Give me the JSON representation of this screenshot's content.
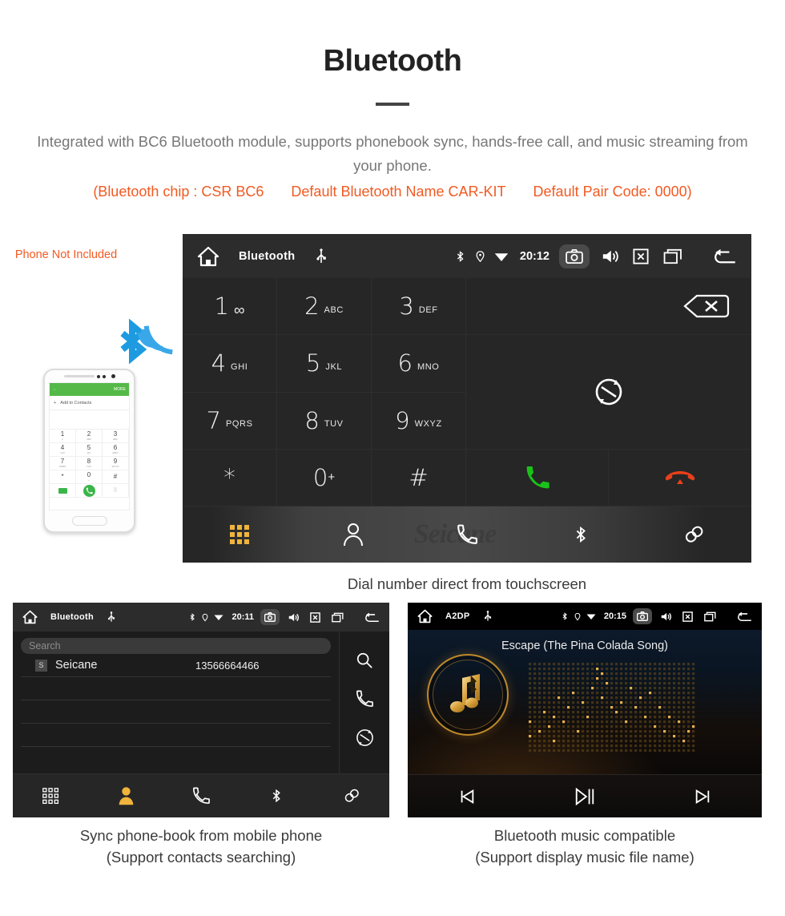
{
  "header": {
    "title": "Bluetooth",
    "subtitle": "Integrated with BC6 Bluetooth module, supports phonebook sync, hands-free call, and music streaming from your phone.",
    "specs": [
      "(Bluetooth chip : CSR BC6",
      "Default Bluetooth Name CAR-KIT",
      "Default Pair Code: 0000)"
    ],
    "accent_color": "#f15a22",
    "subtitle_color": "#777777"
  },
  "dialer": {
    "statusbar": {
      "home_icon": "home-icon",
      "title": "Bluetooth",
      "usb_icon": "usb-icon",
      "bluetooth_icon": "bluetooth-icon",
      "location_icon": "location-pin-icon",
      "wifi_icon": "wifi-icon",
      "time": "20:12",
      "camera_icon": "camera-icon",
      "volume_icon": "volume-icon",
      "close_icon": "close-box-icon",
      "recents_icon": "recent-apps-icon",
      "back_icon": "back-arrow-icon"
    },
    "keys": [
      {
        "digit": "1",
        "letters": "",
        "icon": "voicemail-icon"
      },
      {
        "digit": "2",
        "letters": "ABC",
        "icon": ""
      },
      {
        "digit": "3",
        "letters": "DEF",
        "icon": ""
      },
      {
        "digit": "4",
        "letters": "GHI",
        "icon": ""
      },
      {
        "digit": "5",
        "letters": "JKL",
        "icon": ""
      },
      {
        "digit": "6",
        "letters": "MNO",
        "icon": ""
      },
      {
        "digit": "7",
        "letters": "PQRS",
        "icon": ""
      },
      {
        "digit": "8",
        "letters": "TUV",
        "icon": ""
      },
      {
        "digit": "9",
        "letters": "WXYZ",
        "icon": ""
      },
      {
        "digit": "*",
        "letters": "",
        "icon": ""
      },
      {
        "digit": "0",
        "letters": "",
        "icon": "plus-sup"
      },
      {
        "digit": "#",
        "letters": "",
        "icon": ""
      }
    ],
    "backspace_icon": "backspace-icon",
    "transfer_icon": "audio-transfer-icon",
    "call_icon": "call-answer-icon",
    "hangup_icon": "call-end-icon",
    "call_color": "#19c219",
    "hangup_color": "#e8401a",
    "toolbar": [
      {
        "name": "keypad",
        "icon": "keypad-icon",
        "active": true
      },
      {
        "name": "contacts",
        "icon": "contact-person-icon",
        "active": false
      },
      {
        "name": "call-log",
        "icon": "phone-handset-icon",
        "active": false
      },
      {
        "name": "bluetooth",
        "icon": "bluetooth-icon",
        "active": false
      },
      {
        "name": "pair-link",
        "icon": "link-chain-icon",
        "active": false
      }
    ],
    "watermark": "Seicane",
    "active_color": "#f0b43c",
    "caption": "Dial number direct from touchscreen"
  },
  "phone_illustration": {
    "note": "Phone Not Included",
    "note_color": "#f15a22",
    "bluetooth_signal_icon": "bluetooth-wireless-icon",
    "signal_color": "#1e9be0",
    "screen": {
      "back_icon": "back-arrow-icon",
      "more_label": "MORE",
      "add_label": "Add to Contacts",
      "plus_icon": "plus-icon",
      "keys": [
        {
          "digit": "1",
          "letters": "∞"
        },
        {
          "digit": "2",
          "letters": "ABC"
        },
        {
          "digit": "3",
          "letters": "DEF"
        },
        {
          "digit": "4",
          "letters": "GHI"
        },
        {
          "digit": "5",
          "letters": "JKL"
        },
        {
          "digit": "6",
          "letters": "MNO"
        },
        {
          "digit": "7",
          "letters": "PQRS"
        },
        {
          "digit": "8",
          "letters": "TUV"
        },
        {
          "digit": "9",
          "letters": "WXYZ"
        },
        {
          "digit": "*",
          "letters": ""
        },
        {
          "digit": "0",
          "letters": "+"
        },
        {
          "digit": "#",
          "letters": ""
        }
      ],
      "video_icon": "video-call-icon",
      "call_icon": "call-answer-icon",
      "more_keys_icon": "keypad-icon",
      "green": "#54b948"
    }
  },
  "phonebook": {
    "statusbar": {
      "title": "Bluetooth",
      "time": "20:11"
    },
    "search_placeholder": "Search",
    "contacts": [
      {
        "badge": "S",
        "name": "Seicane",
        "number": "13566664466"
      }
    ],
    "rail": [
      {
        "name": "search",
        "icon": "search-icon"
      },
      {
        "name": "call",
        "icon": "phone-handset-icon"
      },
      {
        "name": "sync",
        "icon": "sync-icon"
      }
    ],
    "toolbar": [
      {
        "name": "keypad",
        "icon": "keypad-icon",
        "active": false
      },
      {
        "name": "contacts",
        "icon": "contact-person-icon",
        "active": true
      },
      {
        "name": "call-log",
        "icon": "phone-handset-icon",
        "active": false
      },
      {
        "name": "bluetooth",
        "icon": "bluetooth-icon",
        "active": false
      },
      {
        "name": "pair-link",
        "icon": "link-chain-icon",
        "active": false
      }
    ],
    "caption_line1": "Sync phone-book from mobile phone",
    "caption_line2": "(Support contacts searching)"
  },
  "music": {
    "statusbar": {
      "title": "A2DP",
      "time": "20:15"
    },
    "song_title": "Escape (The Pina Colada Song)",
    "album_icon": "music-note-bluetooth-icon",
    "visualizer": "dot-matrix-spectrum",
    "accent_color": "#d9a23c",
    "controls": [
      {
        "name": "previous",
        "icon": "skip-previous-icon"
      },
      {
        "name": "play-pause",
        "icon": "play-pause-icon"
      },
      {
        "name": "next",
        "icon": "skip-next-icon"
      }
    ],
    "caption_line1": "Bluetooth music compatible",
    "caption_line2": "(Support display music file name)"
  }
}
